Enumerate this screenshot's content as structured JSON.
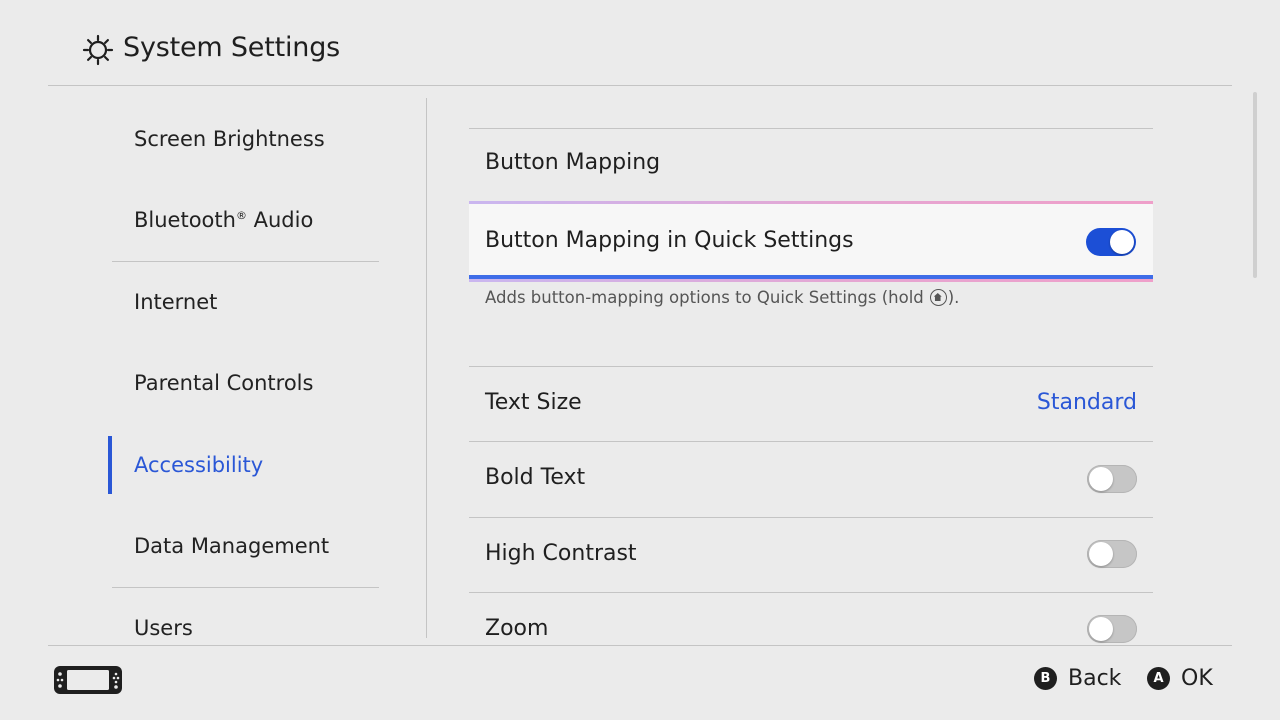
{
  "header": {
    "title": "System Settings",
    "icon": "gear-icon"
  },
  "sidebar": {
    "items": [
      {
        "label": "Screen Brightness"
      },
      {
        "label": "Bluetooth",
        "sup": "®",
        "label_suffix": " Audio"
      },
      {
        "label": "Internet"
      },
      {
        "label": "Parental Controls"
      },
      {
        "label": "Accessibility",
        "active": true
      },
      {
        "label": "Data Management"
      },
      {
        "label": "Users"
      }
    ]
  },
  "content": {
    "section_title": "Button Mapping",
    "focused_row": {
      "label": "Button Mapping in Quick Settings",
      "toggle_on": true
    },
    "description": {
      "before": "Adds button-mapping options to Quick Settings (hold",
      "after": ")."
    },
    "rows": [
      {
        "label": "Text Size",
        "value": "Standard"
      },
      {
        "label": "Bold Text",
        "toggle_on": false
      },
      {
        "label": "High Contrast",
        "toggle_on": false
      },
      {
        "label": "Zoom",
        "toggle_on": false
      }
    ]
  },
  "footer": {
    "back": {
      "button": "B",
      "label": "Back"
    },
    "ok": {
      "button": "A",
      "label": "OK"
    }
  },
  "colors": {
    "accent": "#2a57d6",
    "toggle_on": "#1c4fd6",
    "background": "#ebebeb"
  }
}
